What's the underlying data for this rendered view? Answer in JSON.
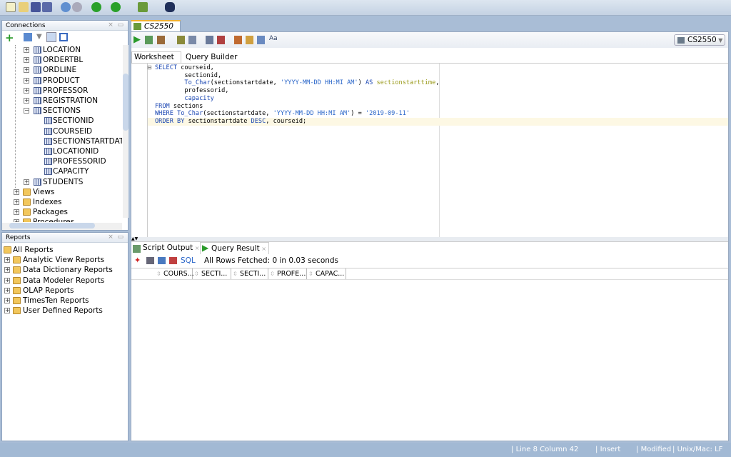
{
  "toolbar": {
    "icons": [
      "new-icon",
      "open-icon",
      "save-icon",
      "save-all-icon",
      "undo-icon",
      "redo-icon",
      "back-icon",
      "forward-icon",
      "sql-worksheet-icon",
      "find-icon"
    ]
  },
  "connections": {
    "title": "Connections",
    "tables": [
      {
        "label": "LOCATION"
      },
      {
        "label": "ORDERTBL"
      },
      {
        "label": "ORDLINE"
      },
      {
        "label": "PRODUCT"
      },
      {
        "label": "PROFESSOR"
      },
      {
        "label": "REGISTRATION"
      },
      {
        "label": "SECTIONS",
        "expanded": true
      }
    ],
    "columns": [
      {
        "label": "SECTIONID"
      },
      {
        "label": "COURSEID"
      },
      {
        "label": "SECTIONSTARTDATI"
      },
      {
        "label": "LOCATIONID"
      },
      {
        "label": "PROFESSORID"
      },
      {
        "label": "CAPACITY"
      }
    ],
    "after": [
      {
        "label": "STUDENTS"
      }
    ],
    "folders": [
      {
        "label": "Views"
      },
      {
        "label": "Indexes"
      },
      {
        "label": "Packages"
      },
      {
        "label": "Procedures"
      }
    ]
  },
  "reports": {
    "title": "Reports",
    "root": "All Reports",
    "items": [
      {
        "label": "Analytic View Reports"
      },
      {
        "label": "Data Dictionary Reports"
      },
      {
        "label": "Data Modeler Reports"
      },
      {
        "label": "OLAP Reports"
      },
      {
        "label": "TimesTen Reports"
      },
      {
        "label": "User Defined Reports"
      }
    ]
  },
  "editor": {
    "tab": "CS2550",
    "connection": "CS2550",
    "subtabs": [
      "Worksheet",
      "Query Builder"
    ],
    "sql_lines": [
      "SELECT courseid,",
      "        sectionid,",
      "        To_Char(sectionstartdate, 'YYYY-MM-DD HH:MI AM') AS sectionstarttime,",
      "        professorid,",
      "        capacity",
      "FROM sections",
      "WHERE To_Char(sectionstartdate, 'YYYY-MM-DD HH:MI AM') = '2019-09-11'",
      "ORDER BY sectionstartdate DESC, courseid;"
    ]
  },
  "results": {
    "tabs": [
      "Script Output",
      "Query Result"
    ],
    "sql_label": "SQL",
    "status": "All Rows Fetched: 0 in 0.03 seconds",
    "columns": [
      "COURS...",
      "SECTI...",
      "SECTI...",
      "PROFE...",
      "CAPAC..."
    ]
  },
  "statusbar": {
    "position": "Line 8 Column 42",
    "mode": "Insert",
    "modified": "Modified",
    "line_endings": "Unix/Mac: LF"
  }
}
